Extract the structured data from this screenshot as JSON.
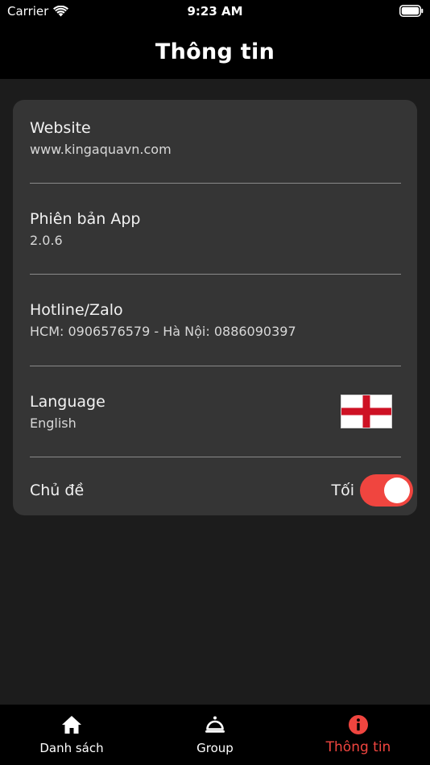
{
  "status_bar": {
    "carrier": "Carrier",
    "time": "9:23 AM"
  },
  "header": {
    "title": "Thông tin"
  },
  "info": {
    "website": {
      "label": "Website",
      "value": "www.kingaquavn.com"
    },
    "app_version": {
      "label": "Phiên bản App",
      "value": "2.0.6"
    },
    "hotline": {
      "label": "Hotline/Zalo",
      "value": "HCM: 0906576579 - Hà Nội: 0886090397"
    },
    "language": {
      "label": "Language",
      "value": "English",
      "flag_icon": "england-flag-icon"
    },
    "theme": {
      "label": "Chủ đề",
      "value": "Tối",
      "enabled": true
    }
  },
  "tabs": [
    {
      "label": "Danh sách",
      "icon": "home-icon",
      "active": false
    },
    {
      "label": "Group",
      "icon": "service-bell-icon",
      "active": false
    },
    {
      "label": "Thông tin",
      "icon": "info-icon",
      "active": true
    }
  ],
  "colors": {
    "accent": "#f0453f",
    "background": "#1c1c1c",
    "card": "#353535",
    "bar": "#000000"
  }
}
